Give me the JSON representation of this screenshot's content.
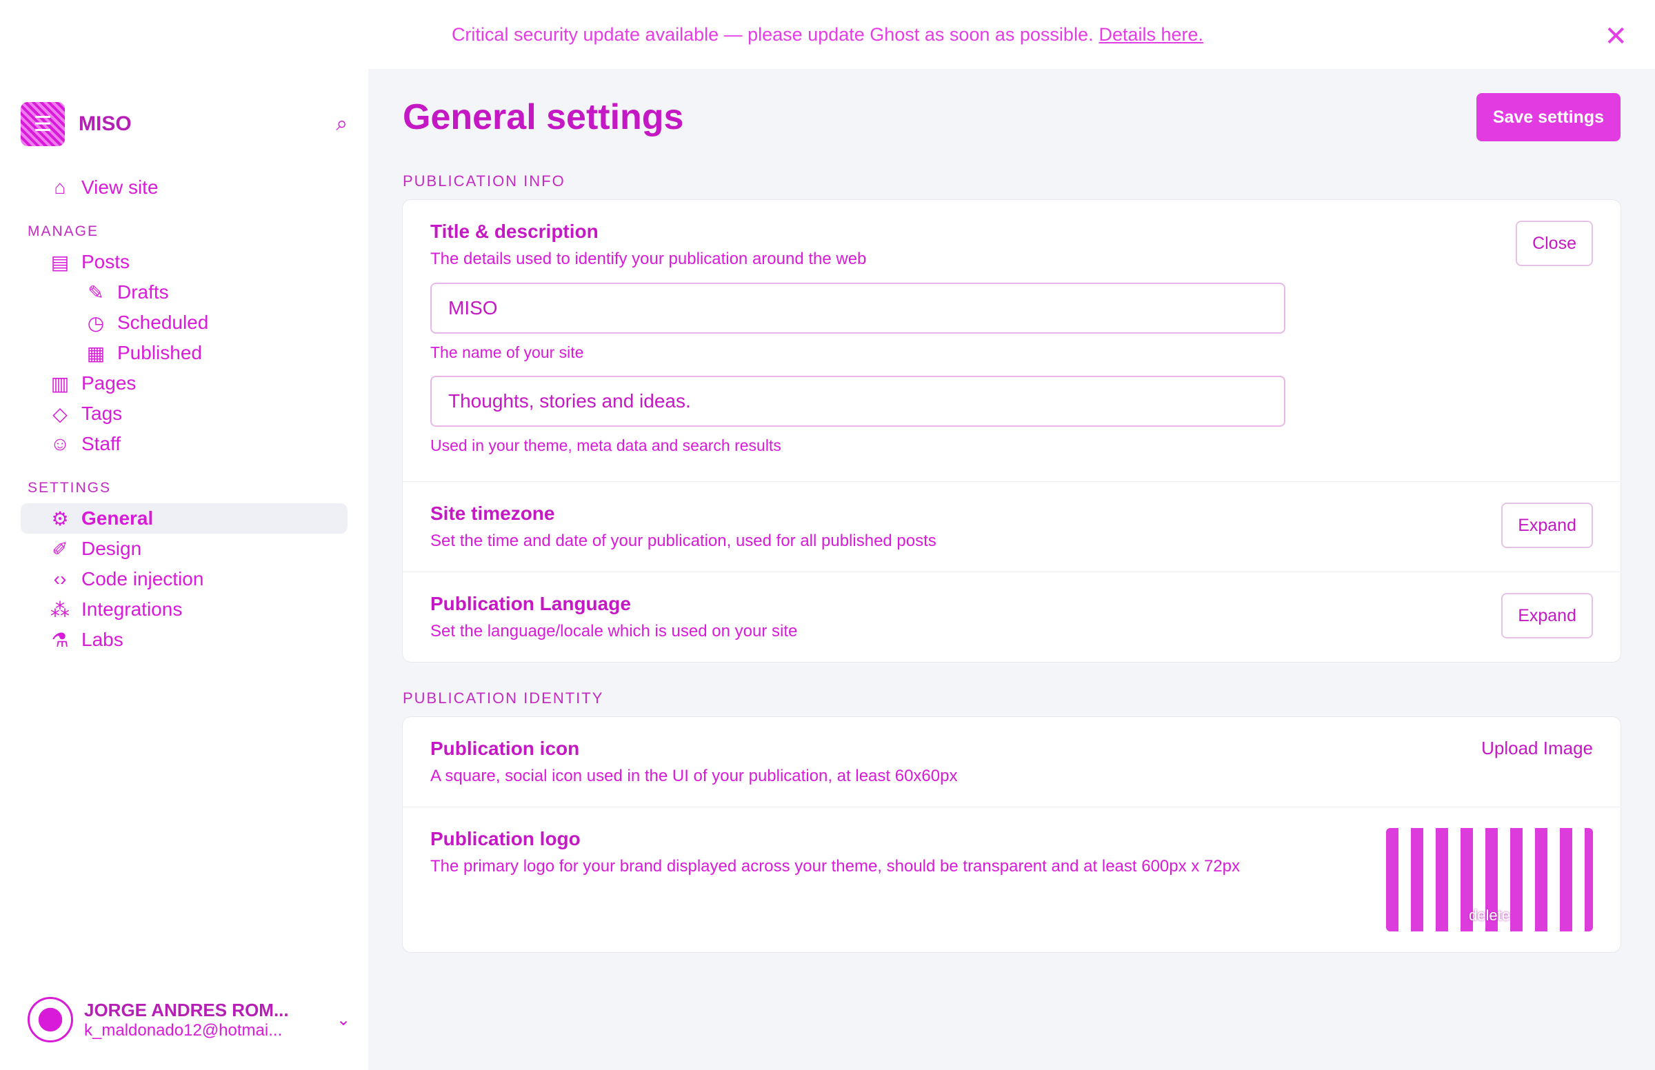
{
  "banner": {
    "text": "Critical security update available — please update Ghost as soon as possible.",
    "link": "Details here."
  },
  "sidebar": {
    "brand": "MISO",
    "view_site": "View site",
    "manage_heading": "MANAGE",
    "posts": "Posts",
    "drafts": "Drafts",
    "scheduled": "Scheduled",
    "published": "Published",
    "pages": "Pages",
    "tags": "Tags",
    "staff": "Staff",
    "settings_heading": "SETTINGS",
    "general": "General",
    "design": "Design",
    "code_injection": "Code injection",
    "integrations": "Integrations",
    "labs": "Labs",
    "user_name": "JORGE ANDRES ROM...",
    "user_email": "k_maldonado12@hotmai..."
  },
  "main": {
    "title": "General settings",
    "save": "Save settings",
    "publication_info": "PUBLICATION INFO",
    "title_desc": {
      "title": "Title & description",
      "desc": "The details used to identify your publication around the web",
      "close": "Close",
      "site_name_value": "MISO",
      "site_name_help": "The name of your site",
      "site_desc_value": "Thoughts, stories and ideas.",
      "site_desc_help": "Used in your theme, meta data and search results"
    },
    "timezone": {
      "title": "Site timezone",
      "desc": "Set the time and date of your publication, used for all published posts",
      "expand": "Expand"
    },
    "language": {
      "title": "Publication Language",
      "desc": "Set the language/locale which is used on your site",
      "expand": "Expand"
    },
    "publication_identity": "PUBLICATION IDENTITY",
    "icon": {
      "title": "Publication icon",
      "desc": "A square, social icon used in the UI of your publication, at least 60x60px",
      "upload": "Upload Image"
    },
    "logo": {
      "title": "Publication logo",
      "desc": "The primary logo for your brand displayed across your theme, should be transparent and at least 600px x 72px",
      "delete": "delete"
    }
  }
}
